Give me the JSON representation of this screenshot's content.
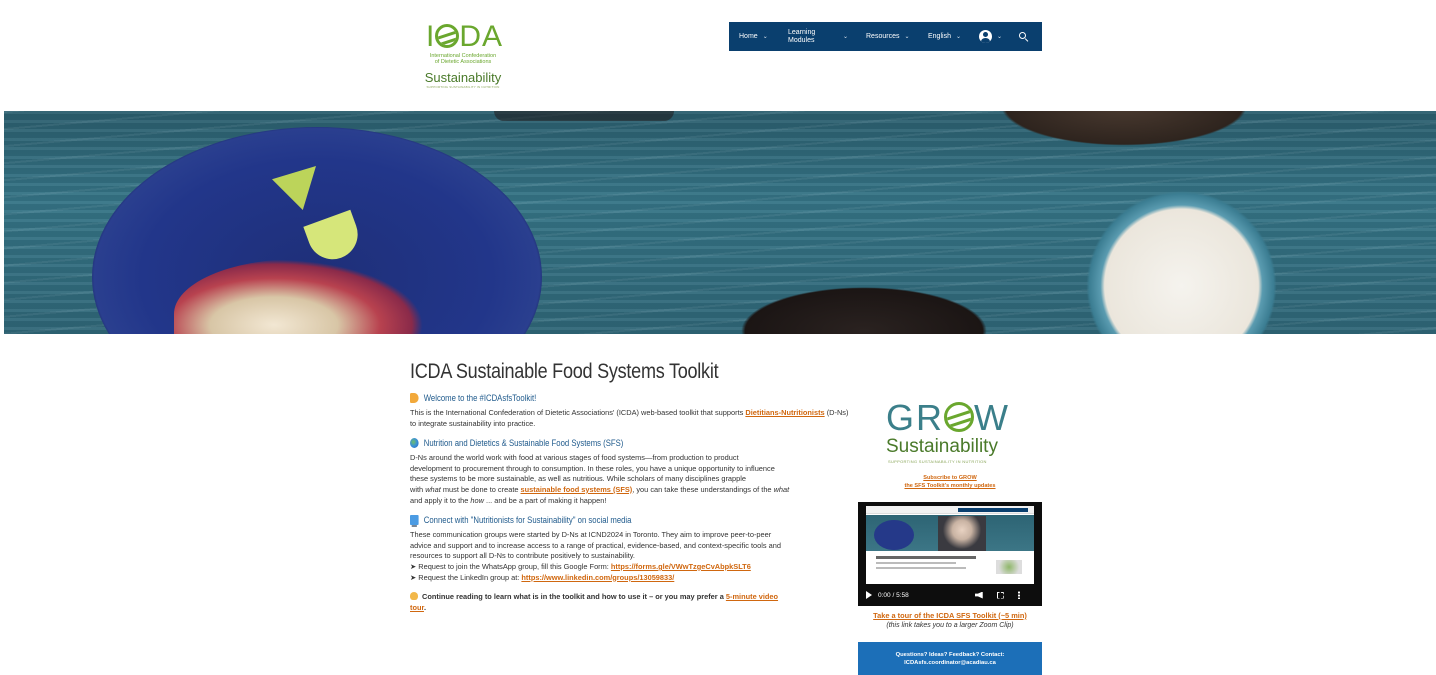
{
  "logo": {
    "mark": "ICDA",
    "subtitle_line1": "International Confederation",
    "subtitle_line2": "of Dietetic Associations",
    "sustainability": "Sustainability",
    "tagline": "SUPPORTING SUSTAINABILITY IN NUTRITION"
  },
  "nav": {
    "items": [
      {
        "label": "Home"
      },
      {
        "label": "Learning Modules"
      },
      {
        "label": "Resources"
      },
      {
        "label": "English"
      }
    ],
    "user_icon": "user-circle-icon",
    "search_icon": "search-icon",
    "background": "#0a3f6e"
  },
  "hero": {
    "image": "hero-food-table-image"
  },
  "main": {
    "title": "ICDA Sustainable Food Systems Toolkit",
    "welcome": {
      "heading": "Welcome to the #ICDAsfsToolkit!",
      "text_before": "This is the International Confederation of Dietetic Associations' (ICDA) web-based toolkit that supports ",
      "link": "Dietitians-Nutritionists",
      "text_after": " (D-Ns) to integrate sustainability into practice."
    },
    "nd_sfs": {
      "heading": "Nutrition and Dietetics & Sustainable Food Systems (SFS)",
      "line1": "D-Ns around the world work with food at various stages of food systems—from production to product",
      "line2": "development to procurement through to consumption. In these roles, you have a unique opportunity to influence",
      "line3": "these systems to be more sustainable, as well as nutritious. While scholars of many disciplines grapple",
      "line4_a": "with ",
      "line4_what": "what",
      "line4_b": " must be done to create ",
      "line4_link": "sustainable food systems (SFS)",
      "line4_c": ", you can take these understandings of the ",
      "line4_what2": "what",
      "line5_a": "and apply it to the ",
      "line5_how": "how",
      "line5_b": " ... and be a part of making it happen!"
    },
    "social": {
      "heading": "Connect with \"Nutritionists for Sustainability\" on social media",
      "line1": "These communication groups were started by D-Ns at ICND2024 in Toronto. They aim to improve peer-to-peer",
      "line2": "advice and support and to increase access to a range of practical, evidence-based, and context-specific tools and",
      "line3": "resources to support all D-Ns to contribute positively to sustainability.",
      "wa_text": "➤ Request to join the WhatsApp group, fill this Google Form: ",
      "wa_link": "https://forms.gle/VWwTzgeCvAbpkSLT6",
      "li_text": "➤ Request the LinkedIn group at:  ",
      "li_link": "https://www.linkedin.com/groups/13059833/"
    },
    "continue": {
      "text": "Continue reading to learn what is in the toolkit and how to use it – or you may prefer a ",
      "link_part1": "5-minute video",
      "link_part2": "tour",
      "end": "."
    }
  },
  "sidebar": {
    "grow_word": "GROW",
    "grow_sustainability": "Sustainability",
    "grow_tagline": "SUPPORTING SUSTAINABILITY IN NUTRITION",
    "subscribe_line1": "Subscribe to GROW",
    "subscribe_line2": "the SFS Toolkit's monthly updates",
    "video_time": "0:00 / 5:58",
    "tour_link": "Take a tour of the ICDA SFS Toolkit (~5 min)",
    "tour_note": "(this link takes you to a larger Zoom Clip)",
    "contact_line1": "Questions? Ideas? Feedback? Contact:",
    "contact_line2": "ICDAsfs.coordinator@acadiau.ca"
  },
  "colors": {
    "link": "#d0670f",
    "heading_blue": "#1f5a8c",
    "contact_bg": "#1c6fb8",
    "logo_green": "#6aa72e"
  }
}
